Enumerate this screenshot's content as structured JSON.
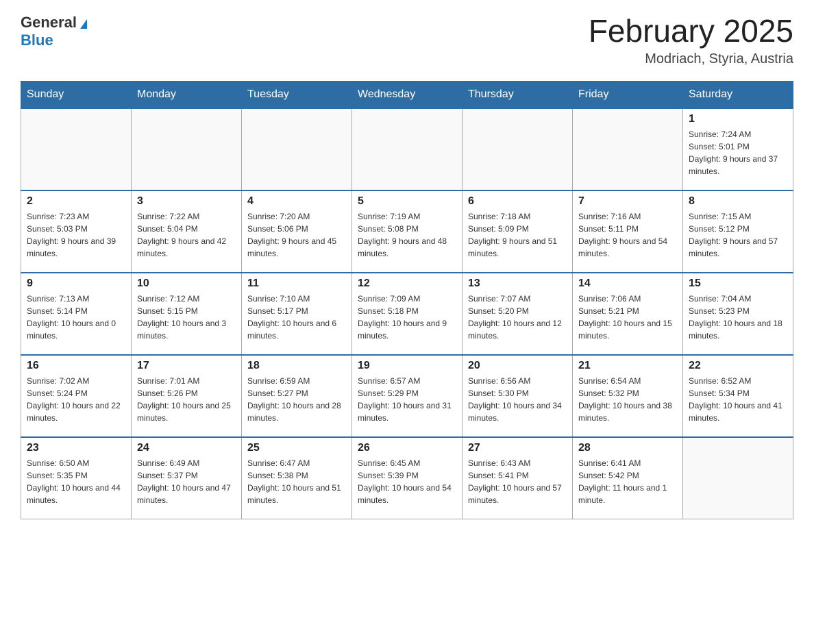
{
  "header": {
    "logo": {
      "general": "General",
      "blue": "Blue",
      "tagline": ""
    },
    "title": "February 2025",
    "location": "Modriach, Styria, Austria"
  },
  "calendar": {
    "days_of_week": [
      "Sunday",
      "Monday",
      "Tuesday",
      "Wednesday",
      "Thursday",
      "Friday",
      "Saturday"
    ],
    "weeks": [
      [
        {
          "day": "",
          "info": ""
        },
        {
          "day": "",
          "info": ""
        },
        {
          "day": "",
          "info": ""
        },
        {
          "day": "",
          "info": ""
        },
        {
          "day": "",
          "info": ""
        },
        {
          "day": "",
          "info": ""
        },
        {
          "day": "1",
          "info": "Sunrise: 7:24 AM\nSunset: 5:01 PM\nDaylight: 9 hours and 37 minutes."
        }
      ],
      [
        {
          "day": "2",
          "info": "Sunrise: 7:23 AM\nSunset: 5:03 PM\nDaylight: 9 hours and 39 minutes."
        },
        {
          "day": "3",
          "info": "Sunrise: 7:22 AM\nSunset: 5:04 PM\nDaylight: 9 hours and 42 minutes."
        },
        {
          "day": "4",
          "info": "Sunrise: 7:20 AM\nSunset: 5:06 PM\nDaylight: 9 hours and 45 minutes."
        },
        {
          "day": "5",
          "info": "Sunrise: 7:19 AM\nSunset: 5:08 PM\nDaylight: 9 hours and 48 minutes."
        },
        {
          "day": "6",
          "info": "Sunrise: 7:18 AM\nSunset: 5:09 PM\nDaylight: 9 hours and 51 minutes."
        },
        {
          "day": "7",
          "info": "Sunrise: 7:16 AM\nSunset: 5:11 PM\nDaylight: 9 hours and 54 minutes."
        },
        {
          "day": "8",
          "info": "Sunrise: 7:15 AM\nSunset: 5:12 PM\nDaylight: 9 hours and 57 minutes."
        }
      ],
      [
        {
          "day": "9",
          "info": "Sunrise: 7:13 AM\nSunset: 5:14 PM\nDaylight: 10 hours and 0 minutes."
        },
        {
          "day": "10",
          "info": "Sunrise: 7:12 AM\nSunset: 5:15 PM\nDaylight: 10 hours and 3 minutes."
        },
        {
          "day": "11",
          "info": "Sunrise: 7:10 AM\nSunset: 5:17 PM\nDaylight: 10 hours and 6 minutes."
        },
        {
          "day": "12",
          "info": "Sunrise: 7:09 AM\nSunset: 5:18 PM\nDaylight: 10 hours and 9 minutes."
        },
        {
          "day": "13",
          "info": "Sunrise: 7:07 AM\nSunset: 5:20 PM\nDaylight: 10 hours and 12 minutes."
        },
        {
          "day": "14",
          "info": "Sunrise: 7:06 AM\nSunset: 5:21 PM\nDaylight: 10 hours and 15 minutes."
        },
        {
          "day": "15",
          "info": "Sunrise: 7:04 AM\nSunset: 5:23 PM\nDaylight: 10 hours and 18 minutes."
        }
      ],
      [
        {
          "day": "16",
          "info": "Sunrise: 7:02 AM\nSunset: 5:24 PM\nDaylight: 10 hours and 22 minutes."
        },
        {
          "day": "17",
          "info": "Sunrise: 7:01 AM\nSunset: 5:26 PM\nDaylight: 10 hours and 25 minutes."
        },
        {
          "day": "18",
          "info": "Sunrise: 6:59 AM\nSunset: 5:27 PM\nDaylight: 10 hours and 28 minutes."
        },
        {
          "day": "19",
          "info": "Sunrise: 6:57 AM\nSunset: 5:29 PM\nDaylight: 10 hours and 31 minutes."
        },
        {
          "day": "20",
          "info": "Sunrise: 6:56 AM\nSunset: 5:30 PM\nDaylight: 10 hours and 34 minutes."
        },
        {
          "day": "21",
          "info": "Sunrise: 6:54 AM\nSunset: 5:32 PM\nDaylight: 10 hours and 38 minutes."
        },
        {
          "day": "22",
          "info": "Sunrise: 6:52 AM\nSunset: 5:34 PM\nDaylight: 10 hours and 41 minutes."
        }
      ],
      [
        {
          "day": "23",
          "info": "Sunrise: 6:50 AM\nSunset: 5:35 PM\nDaylight: 10 hours and 44 minutes."
        },
        {
          "day": "24",
          "info": "Sunrise: 6:49 AM\nSunset: 5:37 PM\nDaylight: 10 hours and 47 minutes."
        },
        {
          "day": "25",
          "info": "Sunrise: 6:47 AM\nSunset: 5:38 PM\nDaylight: 10 hours and 51 minutes."
        },
        {
          "day": "26",
          "info": "Sunrise: 6:45 AM\nSunset: 5:39 PM\nDaylight: 10 hours and 54 minutes."
        },
        {
          "day": "27",
          "info": "Sunrise: 6:43 AM\nSunset: 5:41 PM\nDaylight: 10 hours and 57 minutes."
        },
        {
          "day": "28",
          "info": "Sunrise: 6:41 AM\nSunset: 5:42 PM\nDaylight: 11 hours and 1 minute."
        },
        {
          "day": "",
          "info": ""
        }
      ]
    ]
  }
}
